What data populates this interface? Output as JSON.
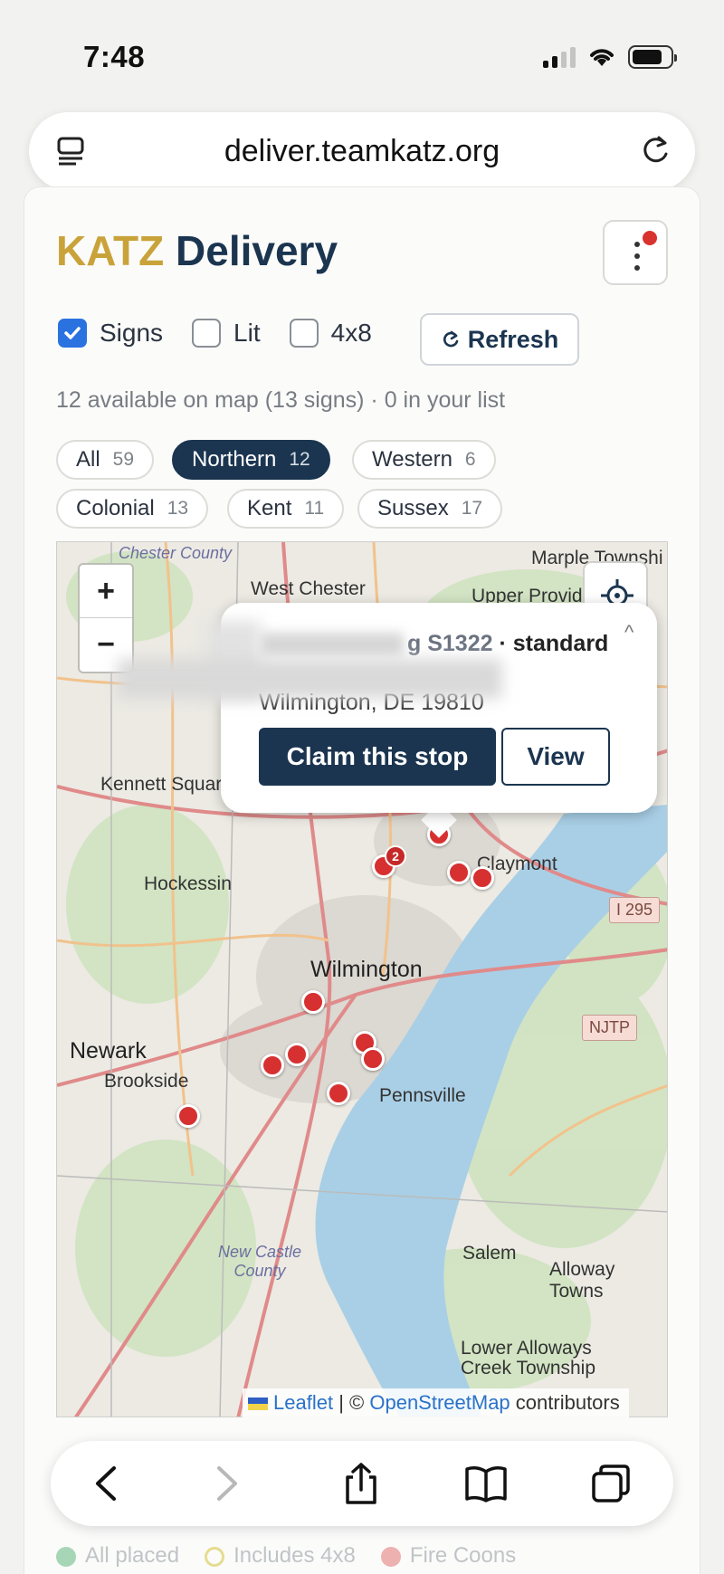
{
  "status": {
    "time": "7:48"
  },
  "browser": {
    "url": "deliver.teamkatz.org"
  },
  "header": {
    "brand_part1": "KATZ",
    "brand_part2": "Delivery"
  },
  "filters": {
    "signs_label": "Signs",
    "signs_checked": true,
    "lit_label": "Lit",
    "lit_checked": false,
    "fourx8_label": "4x8",
    "fourx8_checked": false,
    "refresh_label": "Refresh"
  },
  "summary": "12 available on map (13 signs) · 0 in your list",
  "regions": [
    {
      "label": "All",
      "count": "59",
      "active": false
    },
    {
      "label": "Northern",
      "count": "12",
      "active": true
    },
    {
      "label": "Western",
      "count": "6",
      "active": false
    },
    {
      "label": "Colonial",
      "count": "13",
      "active": false
    },
    {
      "label": "Kent",
      "count": "11",
      "active": false
    },
    {
      "label": "Sussex",
      "count": "17",
      "active": false
    }
  ],
  "map": {
    "zoom_in": "+",
    "zoom_out": "−",
    "labels": {
      "chester_county": "Chester County",
      "west_chester": "West Chester",
      "marple": "Marple Townshi",
      "upper_provid": "Upper Provid",
      "kennett": "Kennett Squar",
      "hockessin": "Hockessin",
      "claymont": "Claymont",
      "wilmington": "Wilmington",
      "newark": "Newark",
      "brookside": "Brookside",
      "pennsville": "Pennsville",
      "new_castle_county": "New Castle County",
      "salem": "Salem",
      "alloway": "Alloway Towns",
      "lower_alloways": "Lower Alloways Creek Township",
      "i295": "I 295",
      "njtp": "NJTP"
    },
    "cluster_count": "2",
    "attribution_leaflet": "Leaflet",
    "attribution_sep": "| ©",
    "attribution_osm": "OpenStreetMap",
    "attribution_tail": "contributors"
  },
  "popup": {
    "stop_id": "g S1322",
    "stop_type": "· standard",
    "address": "Wilmington, DE 19810",
    "claim_label": "Claim this stop",
    "view_label": "View",
    "close_glyph": "^"
  },
  "legend": {
    "all_placed": "All placed",
    "includes_4x8": "Includes 4x8",
    "fire_coons": "Fire Coons"
  },
  "colors": {
    "brand_gold": "#c9a33a",
    "brand_navy": "#1b3550",
    "marker_red": "#d63030",
    "accent_blue": "#2a72e0"
  }
}
